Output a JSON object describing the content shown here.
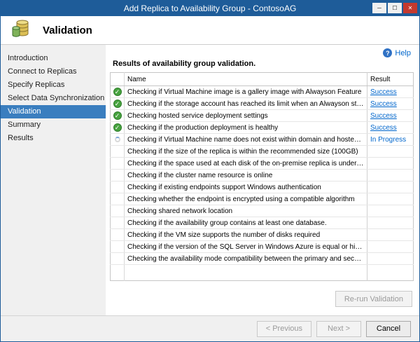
{
  "window": {
    "title": "Add Replica to Availability Group - ContosoAG",
    "controls": {
      "minimize_glyph": "─",
      "maximize_glyph": "☐",
      "close_glyph": "✕"
    }
  },
  "header": {
    "title": "Validation"
  },
  "sidebar": {
    "items": [
      {
        "label": "Introduction",
        "active": false
      },
      {
        "label": "Connect to Replicas",
        "active": false
      },
      {
        "label": "Specify Replicas",
        "active": false
      },
      {
        "label": "Select Data Synchronization",
        "active": false
      },
      {
        "label": "Validation",
        "active": true
      },
      {
        "label": "Summary",
        "active": false
      },
      {
        "label": "Results",
        "active": false
      }
    ]
  },
  "main": {
    "help_label": "Help",
    "help_icon_glyph": "?",
    "heading": "Results of availability group validation.",
    "table": {
      "columns": [
        "Name",
        "Result"
      ],
      "rows": [
        {
          "status": "success",
          "name": "Checking if Virtual Machine image is a gallery image with Alwayson Feature",
          "result": "Success"
        },
        {
          "status": "success",
          "name": "Checking if the storage account has reached its limit when an Alwayson storage...",
          "result": "Success"
        },
        {
          "status": "success",
          "name": "Checking hosted service deployment settings",
          "result": "Success"
        },
        {
          "status": "success",
          "name": "Checking if the production deployment is healthy",
          "result": "Success"
        },
        {
          "status": "in-progress",
          "name": "Checking if Virtual Machine name does not exist within domain and hosted servic...",
          "result": "In Progress"
        },
        {
          "status": "pending",
          "name": "Checking if the size of the replica is within the recommended size (100GB)",
          "result": ""
        },
        {
          "status": "pending",
          "name": "Checking if the space used at each disk of the on-premise replica is under the ma...",
          "result": ""
        },
        {
          "status": "pending",
          "name": "Checking if the cluster name resource is online",
          "result": ""
        },
        {
          "status": "pending",
          "name": "Checking if existing endpoints support Windows authentication",
          "result": ""
        },
        {
          "status": "pending",
          "name": "Checking whether the endpoint is encrypted using a compatible algorithm",
          "result": ""
        },
        {
          "status": "pending",
          "name": "Checking shared network location",
          "result": ""
        },
        {
          "status": "pending",
          "name": "Checking if the availability group contains at least one database.",
          "result": ""
        },
        {
          "status": "pending",
          "name": "Checking if the VM size supports the number of disks required",
          "result": ""
        },
        {
          "status": "pending",
          "name": "Checking if the version of the SQL Server in Windows Azure is equal or higher th...",
          "result": ""
        },
        {
          "status": "pending",
          "name": "Checking the availability mode compatibility between the primary and secondary...",
          "result": ""
        }
      ]
    },
    "rerun_button": "Re-run Validation"
  },
  "footer": {
    "previous": "< Previous",
    "next": "Next >",
    "cancel": "Cancel"
  },
  "colors": {
    "titlebar": "#1e5c99",
    "active_step": "#3a7ebf",
    "link": "#0066cc",
    "success_green": "#47a33f"
  }
}
